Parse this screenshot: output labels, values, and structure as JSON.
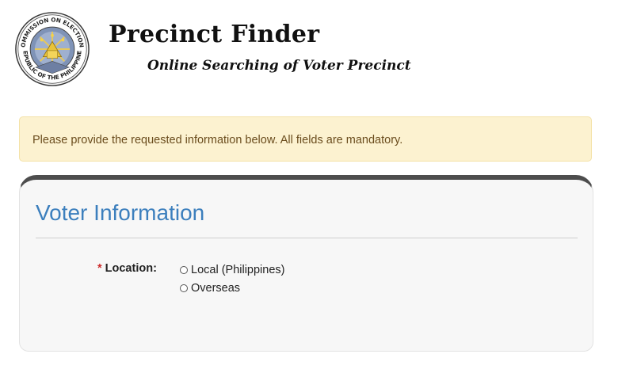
{
  "header": {
    "title": "Precinct Finder",
    "subtitle": "Online Searching of Voter Precinct",
    "seal_icon": "comelec-seal-icon",
    "seal_text_top": "COMMISSION ON ELECTIONS",
    "seal_text_bottom": "REPUBLIC OF THE PHILIPPINES"
  },
  "notice": {
    "text": "Please provide the requested information below. All fields are mandatory."
  },
  "voter_info": {
    "heading": "Voter Information",
    "location": {
      "required_mark": "*",
      "label": "Location:",
      "options": [
        {
          "label": "Local (Philippines)",
          "selected": false
        },
        {
          "label": "Overseas",
          "selected": false
        }
      ]
    }
  },
  "colors": {
    "accent": "#3c7fbd",
    "alert_bg": "#fcf2d0",
    "alert_text": "#6a4c1d",
    "required": "#cc2a2a",
    "panel_top_border": "#4d4d4d"
  }
}
